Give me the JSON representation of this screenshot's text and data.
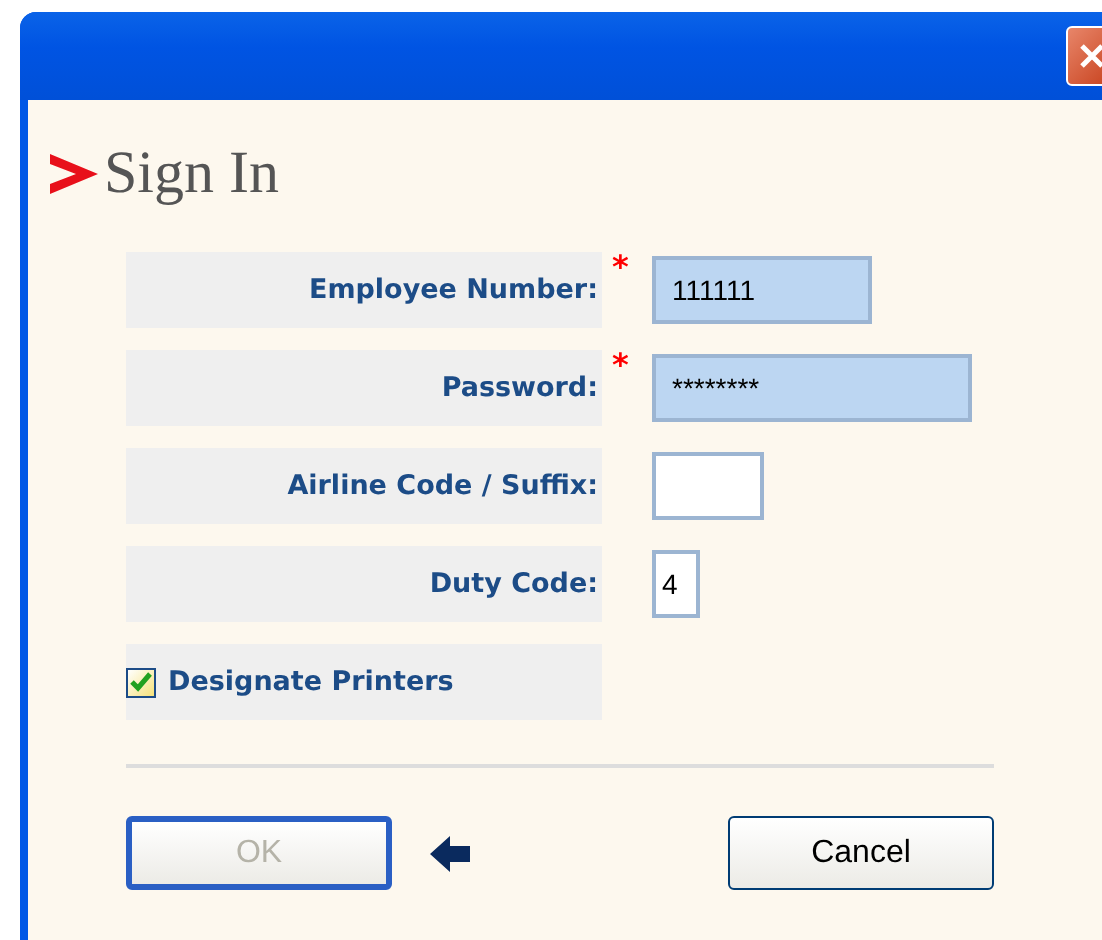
{
  "heading": "Sign In",
  "fields": [
    {
      "label": "Employee Number:",
      "required_mark": "*",
      "kind": "number",
      "value": "111111",
      "focused": true
    },
    {
      "label": "Password:",
      "required_mark": "*",
      "kind": "password",
      "value": "********",
      "focused": true
    },
    {
      "label": "Airline Code / Suffix:",
      "kind": "code",
      "focused": false
    },
    {
      "label": "Duty Code:",
      "kind": "digit",
      "value": "4",
      "focused": false
    }
  ],
  "designate_printers": {
    "label": "Designate Printers",
    "checked": true
  },
  "buttons": [
    {
      "label": "OK",
      "disabled": true,
      "kind": "ok"
    },
    {
      "label": "Cancel",
      "disabled": false,
      "kind": "cancel"
    }
  ]
}
